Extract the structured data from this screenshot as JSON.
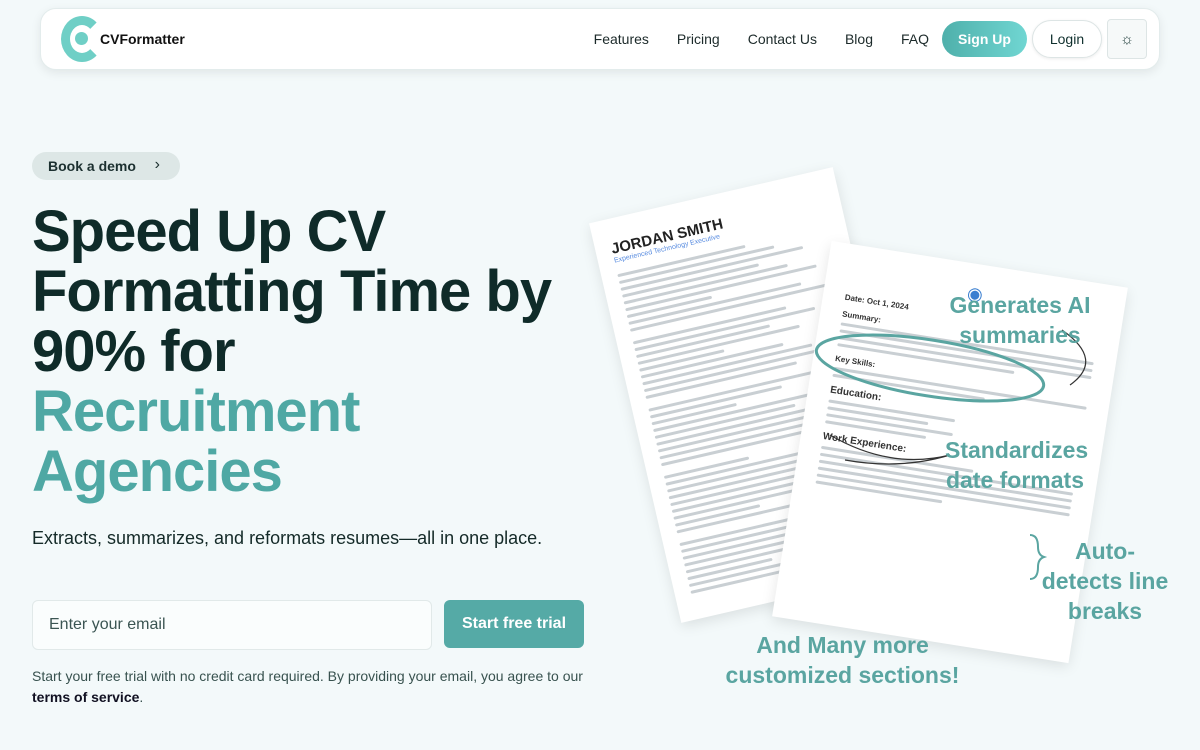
{
  "nav": {
    "brand": "CVFormatter",
    "links": [
      "Features",
      "Pricing",
      "Contact Us",
      "Blog",
      "FAQ"
    ],
    "signup": "Sign Up",
    "login": "Login",
    "theme_icon": "sun-icon"
  },
  "hero": {
    "demo_label": "Book a demo",
    "title_dark": "Speed Up CV Formatting Time by 90% for",
    "title_teal": "Recruitment Agencies",
    "subtitle": "Extracts, summarizes, and reformats resumes—all in one place.",
    "email_placeholder": "Enter your email",
    "trial_button": "Start free trial",
    "fine_print": "Start your free trial with no credit card required. By providing your email, you agree to our ",
    "terms_link": "terms of service",
    "fine_end": "."
  },
  "illustration": {
    "resume_name": "JORDAN SMITH",
    "resume_title": "Experienced Technology Executive",
    "front_date": "Date: Oct 1, 2024",
    "front_sections": [
      "Summary:",
      "Key Skills:",
      "Education:",
      "Work Experience:"
    ],
    "annotations": [
      "Generates  AI summaries",
      "Standardizes date formats",
      "Auto-detects line breaks",
      "And Many more customized sections!"
    ]
  },
  "colors": {
    "accent": "#55aaa6",
    "dark": "#0f2b29",
    "background": "#f3f9fa"
  }
}
